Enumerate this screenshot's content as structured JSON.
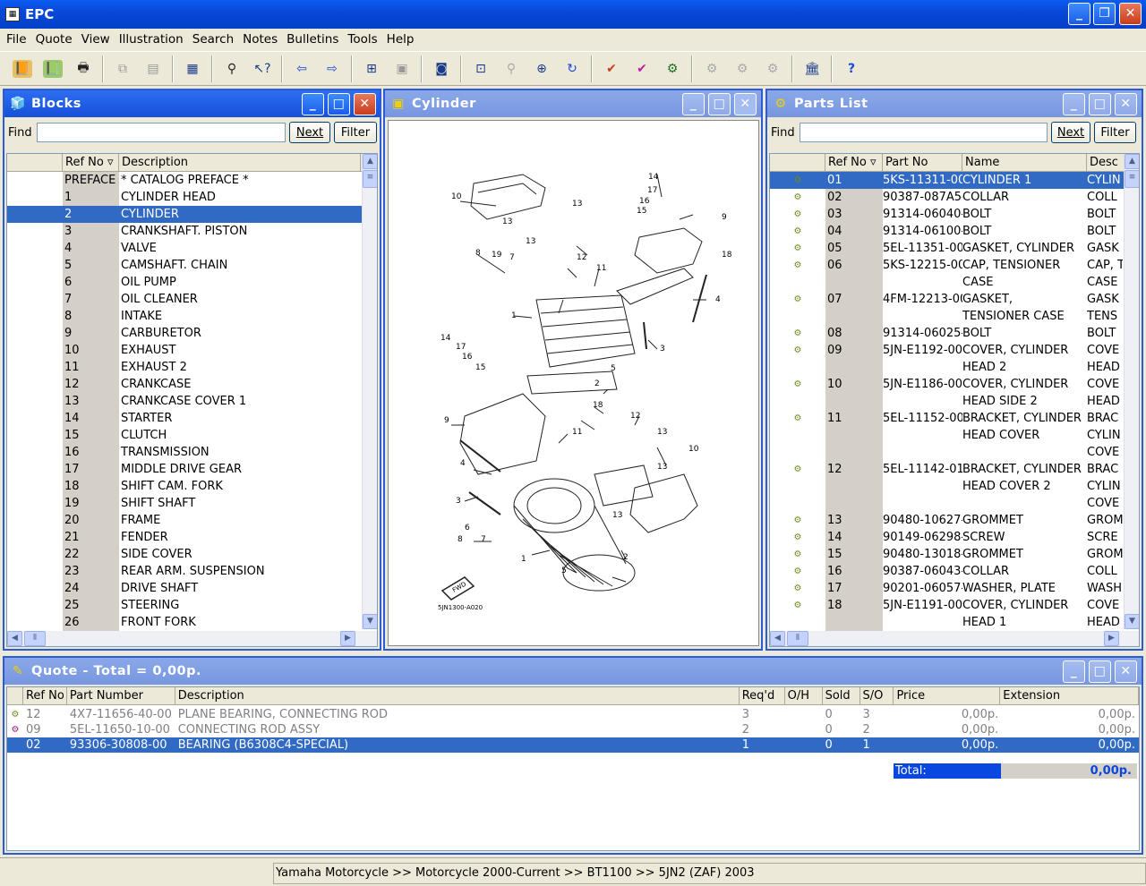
{
  "app": {
    "title": "EPC"
  },
  "menu": [
    "File",
    "Quote",
    "View",
    "Illustration",
    "Search",
    "Notes",
    "Bulletins",
    "Tools",
    "Help"
  ],
  "blocks": {
    "title": "Blocks",
    "find_label": "Find",
    "next": "Next",
    "filter": "Filter",
    "col_ref": "Ref No",
    "col_desc": "Description",
    "rows": [
      {
        "ref": "PREFACE",
        "desc": "* CATALOG PREFACE *"
      },
      {
        "ref": "1",
        "desc": "CYLINDER HEAD"
      },
      {
        "ref": "2",
        "desc": "CYLINDER"
      },
      {
        "ref": "3",
        "desc": "CRANKSHAFT. PISTON"
      },
      {
        "ref": "4",
        "desc": "VALVE"
      },
      {
        "ref": "5",
        "desc": "CAMSHAFT. CHAIN"
      },
      {
        "ref": "6",
        "desc": "OIL PUMP"
      },
      {
        "ref": "7",
        "desc": "OIL CLEANER"
      },
      {
        "ref": "8",
        "desc": "INTAKE"
      },
      {
        "ref": "9",
        "desc": "CARBURETOR"
      },
      {
        "ref": "10",
        "desc": "EXHAUST"
      },
      {
        "ref": "11",
        "desc": "EXHAUST 2"
      },
      {
        "ref": "12",
        "desc": "CRANKCASE"
      },
      {
        "ref": "13",
        "desc": "CRANKCASE COVER 1"
      },
      {
        "ref": "14",
        "desc": "STARTER"
      },
      {
        "ref": "15",
        "desc": "CLUTCH"
      },
      {
        "ref": "16",
        "desc": "TRANSMISSION"
      },
      {
        "ref": "17",
        "desc": "MIDDLE DRIVE GEAR"
      },
      {
        "ref": "18",
        "desc": "SHIFT CAM. FORK"
      },
      {
        "ref": "19",
        "desc": "SHIFT SHAFT"
      },
      {
        "ref": "20",
        "desc": "FRAME"
      },
      {
        "ref": "21",
        "desc": "FENDER"
      },
      {
        "ref": "22",
        "desc": "SIDE COVER"
      },
      {
        "ref": "23",
        "desc": "REAR ARM. SUSPENSION"
      },
      {
        "ref": "24",
        "desc": "DRIVE SHAFT"
      },
      {
        "ref": "25",
        "desc": "STEERING"
      },
      {
        "ref": "26",
        "desc": "FRONT FORK"
      }
    ],
    "selected": "2"
  },
  "cylinder": {
    "title": "Cylinder",
    "diagram_code": "5JN1300-A020",
    "fwd": "FWD",
    "callouts": [
      "14",
      "17",
      "16",
      "15",
      "10",
      "13",
      "9",
      "13",
      "12",
      "13",
      "8",
      "19",
      "7",
      "11",
      "18",
      "4",
      "1",
      "14",
      "17",
      "16",
      "15",
      "3",
      "5",
      "2",
      "18",
      "9",
      "11",
      "12",
      "13",
      "13",
      "10",
      "4",
      "3",
      "6",
      "8",
      "7",
      "1",
      "5",
      "13",
      "2"
    ]
  },
  "parts": {
    "title": "Parts List",
    "find_label": "Find",
    "next": "Next",
    "filter": "Filter",
    "col_ref": "Ref No",
    "col_part": "Part No",
    "col_name": "Name",
    "col_desc": "Desc",
    "rows": [
      {
        "ref": "01",
        "part": "5KS-11311-00-0",
        "name": "CYLINDER 1",
        "desc": "CYLIN"
      },
      {
        "ref": "02",
        "part": "90387-087A5-0",
        "name": "COLLAR",
        "desc": "COLL"
      },
      {
        "ref": "03",
        "part": "91314-06040-0",
        "name": "BOLT",
        "desc": "BOLT"
      },
      {
        "ref": "04",
        "part": "91314-06100-0",
        "name": "BOLT",
        "desc": "BOLT"
      },
      {
        "ref": "05",
        "part": "5EL-11351-00-0",
        "name": "GASKET, CYLINDER",
        "desc": "GASK"
      },
      {
        "ref": "06",
        "part": "5KS-12215-00-0",
        "name": "CAP, TENSIONER",
        "desc": "CAP, T"
      },
      {
        "ref": "",
        "part": "",
        "name": "CASE",
        "desc": "CASE"
      },
      {
        "ref": "07",
        "part": "4FM-12213-00-0",
        "name": "GASKET,",
        "desc": "GASK"
      },
      {
        "ref": "",
        "part": "",
        "name": "TENSIONER CASE",
        "desc": "TENS"
      },
      {
        "ref": "08",
        "part": "91314-06025-0",
        "name": "BOLT",
        "desc": "BOLT"
      },
      {
        "ref": "09",
        "part": "5JN-E1192-00-0",
        "name": "COVER, CYLINDER",
        "desc": "COVE"
      },
      {
        "ref": "",
        "part": "",
        "name": "HEAD 2",
        "desc": "HEAD"
      },
      {
        "ref": "10",
        "part": "5JN-E1186-00-0",
        "name": "COVER, CYLINDER",
        "desc": "COVE"
      },
      {
        "ref": "",
        "part": "",
        "name": "HEAD SIDE 2",
        "desc": "HEAD"
      },
      {
        "ref": "11",
        "part": "5EL-11152-00-0",
        "name": "BRACKET, CYLINDER",
        "desc": "BRAC"
      },
      {
        "ref": "",
        "part": "",
        "name": "HEAD COVER",
        "desc": "CYLIN"
      },
      {
        "ref": "",
        "part": "",
        "name": "",
        "desc": "COVE"
      },
      {
        "ref": "12",
        "part": "5EL-11142-01-0",
        "name": "BRACKET, CYLINDER",
        "desc": "BRAC"
      },
      {
        "ref": "",
        "part": "",
        "name": "HEAD COVER 2",
        "desc": "CYLIN"
      },
      {
        "ref": "",
        "part": "",
        "name": "",
        "desc": "COVE"
      },
      {
        "ref": "13",
        "part": "90480-10627-0",
        "name": "GROMMET",
        "desc": "GROM"
      },
      {
        "ref": "14",
        "part": "90149-06298-0",
        "name": "SCREW",
        "desc": "SCRE"
      },
      {
        "ref": "15",
        "part": "90480-13018-0",
        "name": "GROMMET",
        "desc": "GROM"
      },
      {
        "ref": "16",
        "part": "90387-06043-0",
        "name": "COLLAR",
        "desc": "COLL"
      },
      {
        "ref": "17",
        "part": "90201-06057-0",
        "name": "WASHER, PLATE",
        "desc": "WASH"
      },
      {
        "ref": "18",
        "part": "5JN-E1191-00-0",
        "name": "COVER, CYLINDER",
        "desc": "COVE"
      },
      {
        "ref": "",
        "part": "",
        "name": "HEAD 1",
        "desc": "HEAD"
      }
    ]
  },
  "quote": {
    "title": "Quote - Total = 0,00р.",
    "cols": [
      "Ref No",
      "Part Number",
      "Description",
      "Req'd",
      "O/H",
      "Sold",
      "S/O",
      "Price",
      "Extension"
    ],
    "rows": [
      {
        "ref": "12",
        "part": "4X7-11656-40-00",
        "desc": "PLANE BEARING, CONNECTING ROD",
        "req": "3",
        "oh": "",
        "sold": "0",
        "so": "3",
        "price": "0,00р.",
        "ext": "0,00р."
      },
      {
        "ref": "09",
        "part": "5EL-11650-10-00",
        "desc": "CONNECTING ROD ASSY",
        "req": "2",
        "oh": "",
        "sold": "0",
        "so": "2",
        "price": "0,00р.",
        "ext": "0,00р."
      },
      {
        "ref": "02",
        "part": "93306-30808-00",
        "desc": "BEARING (B6308C4-SPECIAL)",
        "req": "1",
        "oh": "",
        "sold": "0",
        "so": "1",
        "price": "0,00р.",
        "ext": "0,00р."
      }
    ],
    "total_label": "Total:",
    "total_value": "0,00р."
  },
  "status": {
    "breadcrumb": "Yamaha Motorcycle >> Motorcycle 2000-Current >> BT1100 >> 5JN2 (ZAF) 2003"
  },
  "colors": {
    "selection": "#316ac5",
    "titlebar": "#0848d8"
  }
}
